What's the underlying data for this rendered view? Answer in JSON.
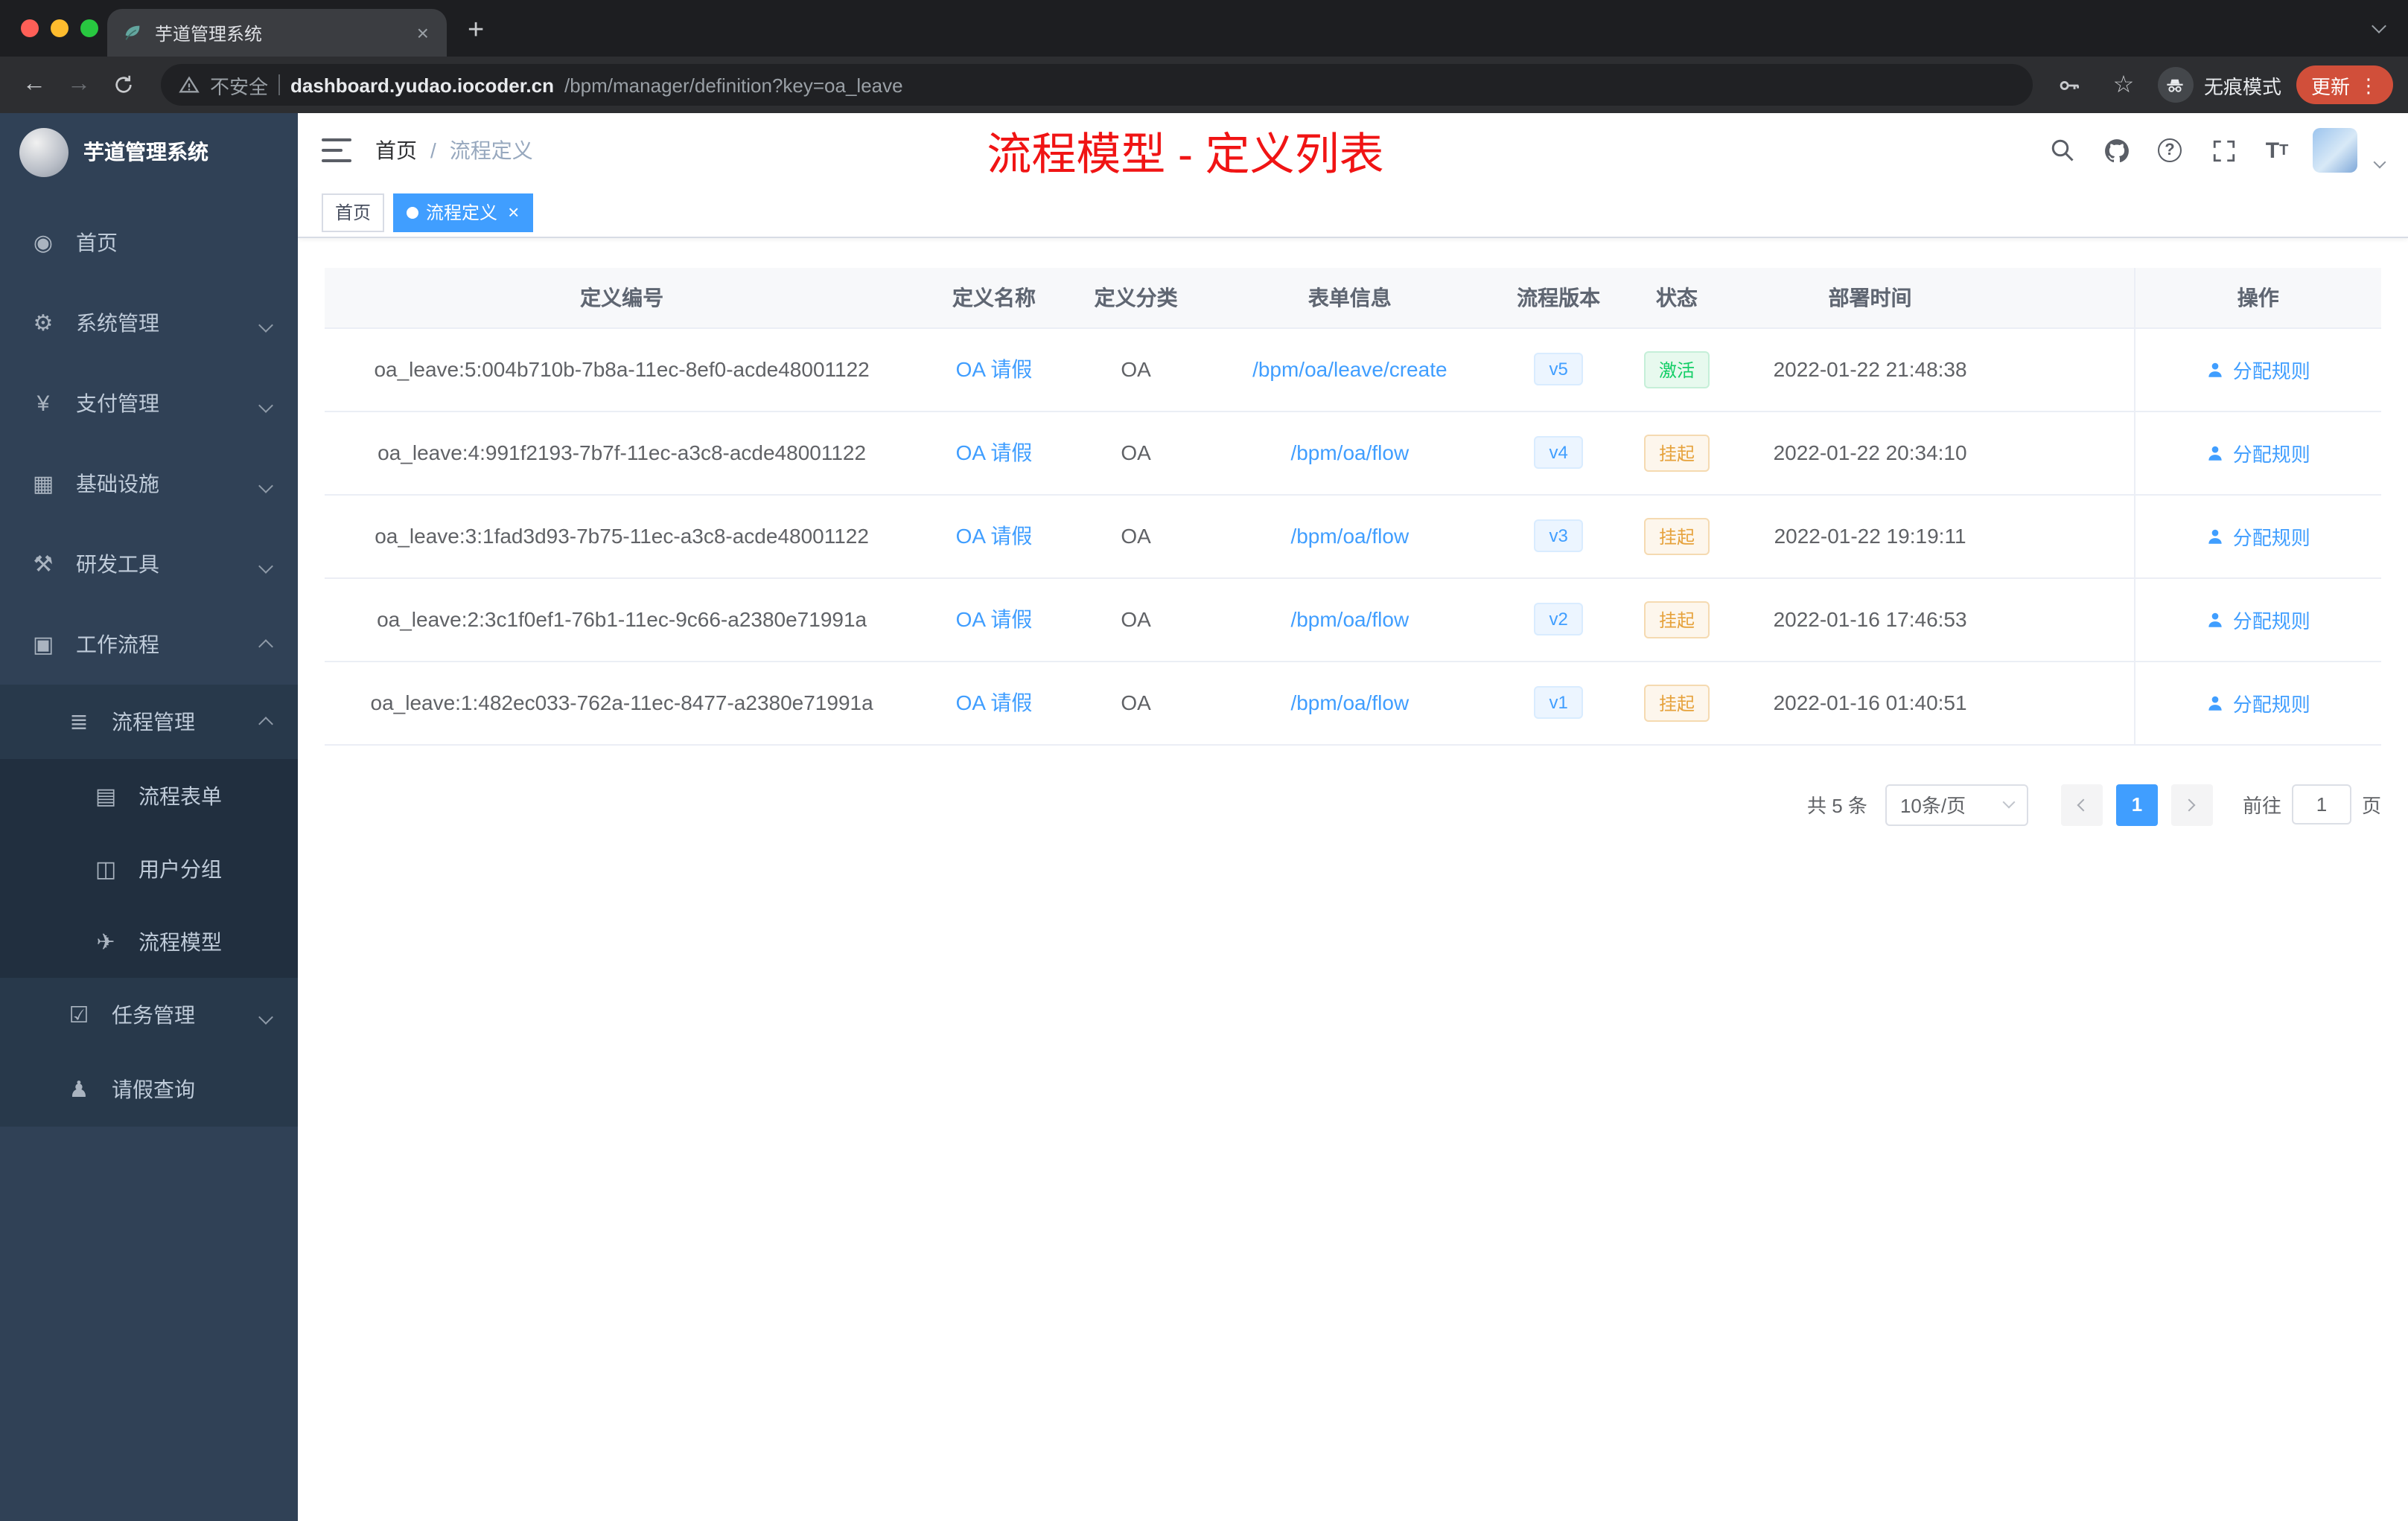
{
  "browser": {
    "tab_title": "芋道管理系统",
    "security_label": "不安全",
    "url_domain": "dashboard.yudao.iocoder.cn",
    "url_path": "/bpm/manager/definition?key=oa_leave",
    "incognito_label": "无痕模式",
    "update_label": "更新"
  },
  "icons": {
    "back": "←",
    "forward": "→",
    "star": "☆",
    "plus": "+",
    "close": "×",
    "kebab": "⋮",
    "menu-home": "◉",
    "menu-system": "⚙",
    "menu-pay": "¥",
    "menu-infra": "▦",
    "menu-dev": "⚒",
    "menu-workflow": "▣",
    "menu-process": "≣",
    "menu-form": "▤",
    "menu-group": "◫",
    "menu-model": "✈",
    "menu-task": "☑",
    "menu-person": "♟",
    "help": "?",
    "tsize-big": "T",
    "tsize-small": "T"
  },
  "sidebar": {
    "app_title": "芋道管理系统",
    "items": [
      {
        "label": "首页"
      },
      {
        "label": "系统管理"
      },
      {
        "label": "支付管理"
      },
      {
        "label": "基础设施"
      },
      {
        "label": "研发工具"
      },
      {
        "label": "工作流程"
      },
      {
        "label": "流程管理"
      },
      {
        "label": "流程表单"
      },
      {
        "label": "用户分组"
      },
      {
        "label": "流程模型"
      },
      {
        "label": "任务管理"
      },
      {
        "label": "请假查询"
      }
    ]
  },
  "header": {
    "breadcrumb": [
      "首页",
      "流程定义"
    ],
    "breadcrumb_sep": "/",
    "annotation": "流程模型 - 定义列表"
  },
  "tags": [
    {
      "label": "首页"
    },
    {
      "label": "流程定义"
    }
  ],
  "table": {
    "headers": [
      "定义编号",
      "定义名称",
      "定义分类",
      "表单信息",
      "流程版本",
      "状态",
      "部署时间",
      "操作"
    ],
    "rows": [
      {
        "id": "oa_leave:5:004b710b-7b8a-11ec-8ef0-acde48001122",
        "name": "OA 请假",
        "category": "OA",
        "form": "/bpm/oa/leave/create",
        "version": "v5",
        "status": "激活",
        "status_type": "success",
        "time": "2022-01-22 21:48:38",
        "action": "分配规则"
      },
      {
        "id": "oa_leave:4:991f2193-7b7f-11ec-a3c8-acde48001122",
        "name": "OA 请假",
        "category": "OA",
        "form": "/bpm/oa/flow",
        "version": "v4",
        "status": "挂起",
        "status_type": "warning",
        "time": "2022-01-22 20:34:10",
        "action": "分配规则"
      },
      {
        "id": "oa_leave:3:1fad3d93-7b75-11ec-a3c8-acde48001122",
        "name": "OA 请假",
        "category": "OA",
        "form": "/bpm/oa/flow",
        "version": "v3",
        "status": "挂起",
        "status_type": "warning",
        "time": "2022-01-22 19:19:11",
        "action": "分配规则"
      },
      {
        "id": "oa_leave:2:3c1f0ef1-76b1-11ec-9c66-a2380e71991a",
        "name": "OA 请假",
        "category": "OA",
        "form": "/bpm/oa/flow",
        "version": "v2",
        "status": "挂起",
        "status_type": "warning",
        "time": "2022-01-16 17:46:53",
        "action": "分配规则"
      },
      {
        "id": "oa_leave:1:482ec033-762a-11ec-8477-a2380e71991a",
        "name": "OA 请假",
        "category": "OA",
        "form": "/bpm/oa/flow",
        "version": "v1",
        "status": "挂起",
        "status_type": "warning",
        "time": "2022-01-16 01:40:51",
        "action": "分配规则"
      }
    ]
  },
  "pagination": {
    "total": "共 5 条",
    "page_size": "10条/页",
    "current_page": "1",
    "goto_label": "前往",
    "goto_value": "1",
    "goto_unit": "页"
  },
  "colors": {
    "accent": "#409eff",
    "annotation_red": "#f01414",
    "status_success": "#13ce66",
    "status_warning": "#e6a23c",
    "sidebar_bg": "#304156",
    "update_pill": "#d14f3a"
  }
}
